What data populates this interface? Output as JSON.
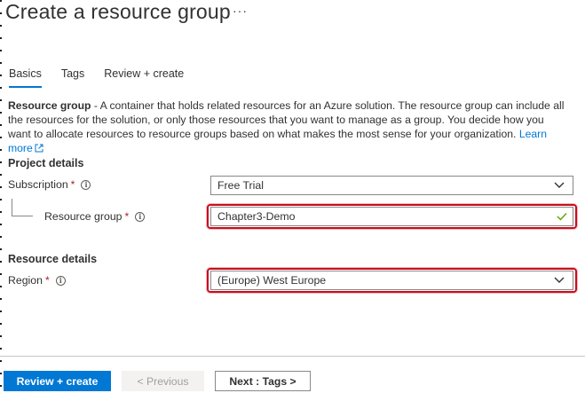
{
  "header": {
    "title": "Create a resource group",
    "more": "···"
  },
  "tabs": [
    {
      "label": "Basics",
      "active": true
    },
    {
      "label": "Tags",
      "active": false
    },
    {
      "label": "Review + create",
      "active": false
    }
  ],
  "description": {
    "term": "Resource group",
    "text": " - A container that holds related resources for an Azure solution. The resource group can include all the resources for the solution, or only those resources that you want to manage as a group. You decide how you want to allocate resources to resource groups based on what makes the most sense for your organization. ",
    "link": "Learn more"
  },
  "project_details": {
    "heading": "Project details",
    "subscription_label": "Subscription",
    "subscription_value": "Free Trial",
    "resource_group_label": "Resource group",
    "resource_group_value": "Chapter3-Demo"
  },
  "resource_details": {
    "heading": "Resource details",
    "region_label": "Region",
    "region_value": "(Europe) West Europe"
  },
  "required_mark": "*",
  "footer": {
    "review_create": "Review + create",
    "previous": "< Previous",
    "next": "Next : Tags >"
  },
  "colors": {
    "accent": "#0078d4",
    "highlight": "#c50f1f",
    "required": "#a4262c"
  }
}
